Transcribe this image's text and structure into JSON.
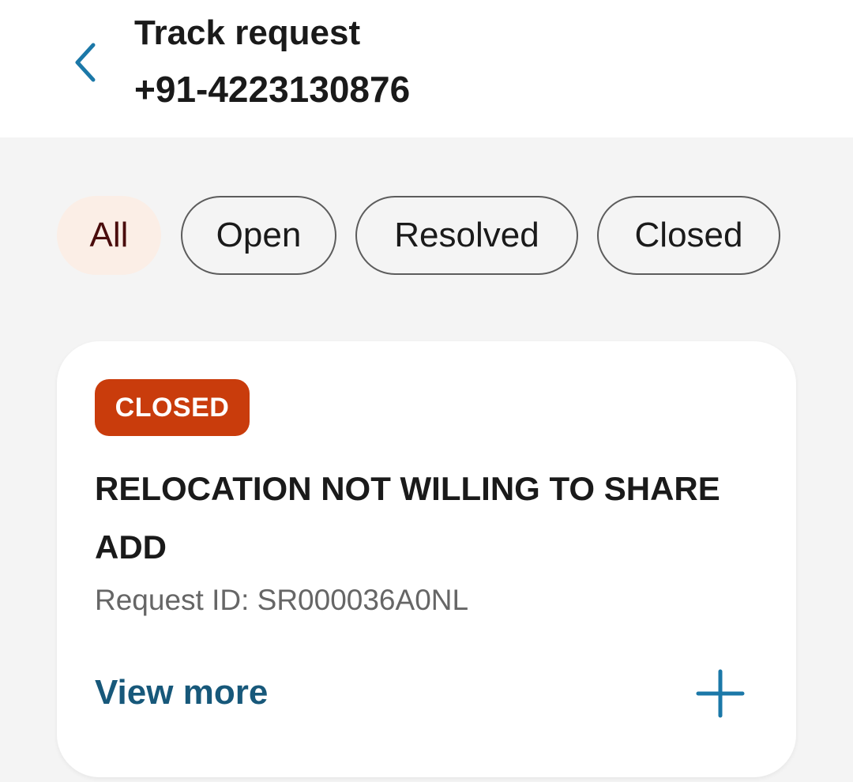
{
  "header": {
    "back_icon": "chevron-left-icon",
    "title": "Track request",
    "subtitle": "+91-4223130876"
  },
  "filters": {
    "active": "All",
    "items": [
      {
        "label": "All"
      },
      {
        "label": "Open"
      },
      {
        "label": "Resolved"
      },
      {
        "label": "Closed"
      }
    ]
  },
  "request": {
    "status": "CLOSED",
    "title": "RELOCATION NOT WILLING TO SHARE ADD",
    "id_text": "Request ID: SR000036A0NL",
    "view_more_label": "View more",
    "expand_icon": "plus-icon"
  },
  "colors": {
    "accent": "#17587a",
    "icon_blue": "#1b78a8",
    "status_closed": "#c93c0c",
    "chip_active_bg": "#fbeee6",
    "chip_active_text": "#4a0c0c"
  }
}
